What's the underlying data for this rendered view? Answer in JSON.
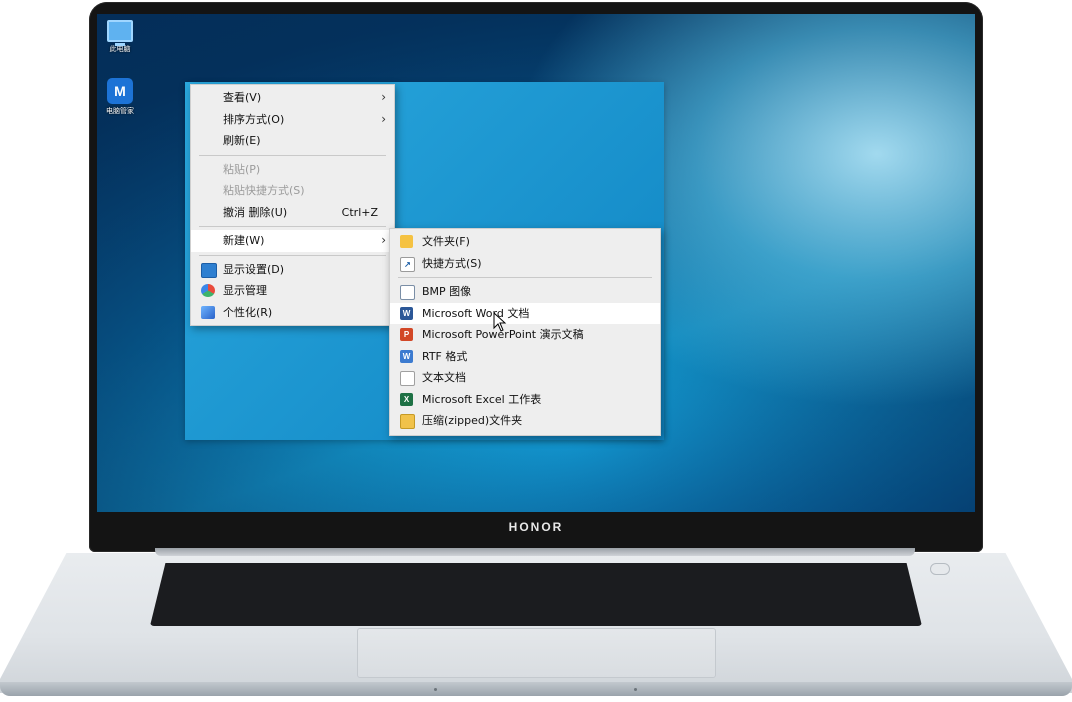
{
  "laptop": {
    "brand": "HONOR"
  },
  "desktop_icons": [
    {
      "label": "此电脑",
      "icon": "computer-icon"
    },
    {
      "label": "电脑管家",
      "icon": "pc-manager-icon",
      "glyph": "M"
    }
  ],
  "context_menu": {
    "items": [
      {
        "label": "查看(V)",
        "submenu": true
      },
      {
        "label": "排序方式(O)",
        "submenu": true
      },
      {
        "label": "刷新(E)"
      },
      {
        "label": "粘贴(P)",
        "disabled": true
      },
      {
        "label": "粘贴快捷方式(S)",
        "disabled": true
      },
      {
        "label": "撤消 删除(U)",
        "shortcut": "Ctrl+Z"
      },
      {
        "label": "新建(W)",
        "submenu": true,
        "highlighted": true
      },
      {
        "label": "显示设置(D)",
        "icon": "display-settings-icon"
      },
      {
        "label": "显示管理",
        "icon": "display-manager-icon"
      },
      {
        "label": "个性化(R)",
        "icon": "personalize-icon"
      }
    ],
    "arrow_glyph": "›"
  },
  "new_submenu": {
    "items": [
      {
        "label": "文件夹(F)",
        "icon": "folder-icon"
      },
      {
        "label": "快捷方式(S)",
        "icon": "shortcut-icon"
      },
      {
        "label": "BMP 图像",
        "icon": "bmp-image-icon"
      },
      {
        "label": "Microsoft Word 文档",
        "icon": "word-document-icon",
        "highlighted": true
      },
      {
        "label": "Microsoft PowerPoint 演示文稿",
        "icon": "powerpoint-icon"
      },
      {
        "label": "RTF 格式",
        "icon": "rtf-document-icon"
      },
      {
        "label": "文本文档",
        "icon": "text-document-icon"
      },
      {
        "label": "Microsoft Excel 工作表",
        "icon": "excel-icon"
      },
      {
        "label": "压缩(zipped)文件夹",
        "icon": "zip-folder-icon"
      }
    ]
  },
  "colors": {
    "word": "#2b5797",
    "powerpoint": "#d24726",
    "excel": "#1e7145",
    "folder": "#f5c242"
  }
}
